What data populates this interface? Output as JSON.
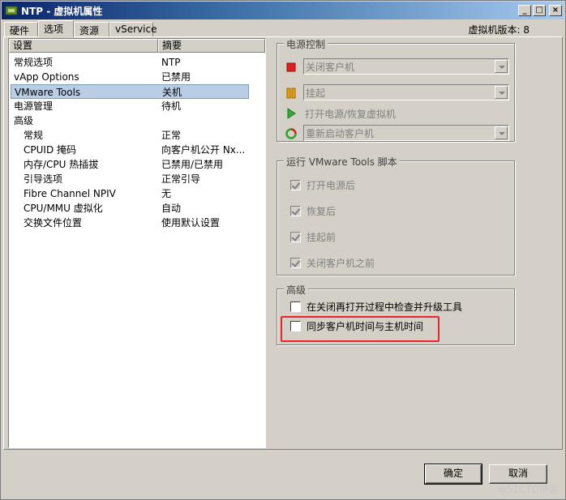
{
  "window": {
    "title": "NTP - 虚拟机属性"
  },
  "title_buttons": {
    "minimize": "_",
    "maximize": "□",
    "close": "×"
  },
  "tabs": [
    {
      "label": "硬件"
    },
    {
      "label": "选项"
    },
    {
      "label": "资源"
    },
    {
      "label": "vService"
    }
  ],
  "vm_version": "虚拟机版本: 8",
  "settings_list": {
    "col_setting": "设置",
    "col_summary": "摘要",
    "rows": [
      {
        "setting": "常规选项",
        "summary": "NTP"
      },
      {
        "setting": "vApp Options",
        "summary": "已禁用"
      },
      {
        "setting": "VMware Tools",
        "summary": "关机"
      },
      {
        "setting": "电源管理",
        "summary": "待机"
      },
      {
        "setting": "高级",
        "summary": ""
      },
      {
        "setting": "常规",
        "summary": "正常"
      },
      {
        "setting": "CPUID 掩码",
        "summary": "向客户机公开 Nx..."
      },
      {
        "setting": "内存/CPU 热插拔",
        "summary": "已禁用/已禁用"
      },
      {
        "setting": "引导选项",
        "summary": "正常引导"
      },
      {
        "setting": "Fibre Channel NPIV",
        "summary": "无"
      },
      {
        "setting": "CPU/MMU 虚拟化",
        "summary": "自动"
      },
      {
        "setting": "交换文件位置",
        "summary": "使用默认设置"
      }
    ]
  },
  "power_controls": {
    "legend": "电源控制",
    "power_off": "关闭客户机",
    "suspend": "挂起",
    "power_on": "打开电源/恢复虚拟机",
    "restart": "重新启动客户机",
    "colors": {
      "stop": "#e02020",
      "suspend": "#e8a000",
      "play": "#30b030"
    }
  },
  "run_scripts": {
    "legend": "运行 VMware Tools 脚本",
    "after_power_on": "打开电源后",
    "after_resume": "恢复后",
    "before_suspend": "挂起前",
    "before_shutdown": "关闭客户机之前"
  },
  "advanced": {
    "legend": "高级",
    "check_upgrade": "在关闭再打开过程中检查并升级工具",
    "sync_time": "同步客户机时间与主机时间"
  },
  "buttons": {
    "ok": "确定",
    "cancel": "取消"
  },
  "watermark": "@51CTO博客",
  "highlight_color": "#e8242a"
}
